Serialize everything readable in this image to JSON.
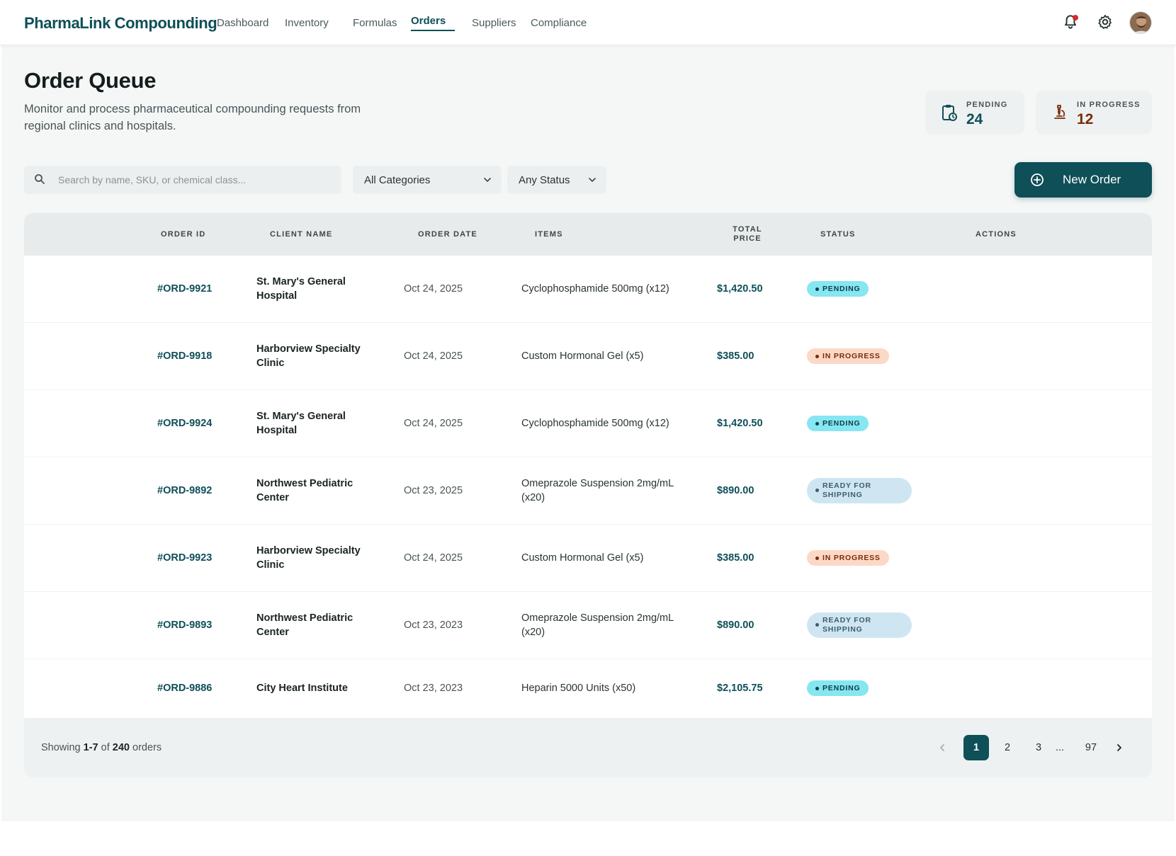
{
  "app": {
    "brand": "PharmaLink Compounding"
  },
  "nav": {
    "items": [
      {
        "label": "Dashboard",
        "active": false
      },
      {
        "label": "Inventory",
        "active": false
      },
      {
        "label": "Formulas",
        "active": false
      },
      {
        "label": "Orders",
        "active": true
      },
      {
        "label": "Suppliers",
        "active": false
      },
      {
        "label": "Compliance",
        "active": false
      }
    ],
    "icons": [
      "bell-icon",
      "gear-icon",
      "avatar"
    ]
  },
  "header": {
    "title": "Order Queue",
    "description": "Monitor and process pharmaceutical compounding requests from regional clinics and hospitals."
  },
  "stats": [
    {
      "label": "PENDING",
      "value": "24",
      "icon": "clipboard-clock-icon",
      "color": "#0f4f58"
    },
    {
      "label": "IN PROGRESS",
      "value": "12",
      "icon": "microscope-icon",
      "color": "#7a2b09"
    }
  ],
  "filters": {
    "search_placeholder": "Search by name, SKU, or chemical class...",
    "category": "All Categories",
    "status": "Any Status",
    "new_order_label": "New Order"
  },
  "table": {
    "columns": [
      "ORDER ID",
      "CLIENT NAME",
      "ORDER DATE",
      "ITEMS",
      "TOTAL PRICE",
      "STATUS",
      "ACTIONS"
    ],
    "rows": [
      {
        "id": "#ORD-9921",
        "client": "St. Mary's General Hospital",
        "date": "Oct 24, 2025",
        "items": "Cyclophosphamide 500mg (x12)",
        "price": "$1,420.50",
        "status": "PENDING",
        "status_kind": "pending"
      },
      {
        "id": "#ORD-9918",
        "client": "Harborview Specialty Clinic",
        "date": "Oct 24, 2025",
        "items": "Custom Hormonal Gel (x5)",
        "price": "$385.00",
        "status": "IN PROGRESS",
        "status_kind": "progress"
      },
      {
        "id": "#ORD-9924",
        "client": "St. Mary's General Hospital",
        "date": "Oct 24, 2025",
        "items": "Cyclophosphamide 500mg (x12)",
        "price": "$1,420.50",
        "status": "PENDING",
        "status_kind": "pending"
      },
      {
        "id": "#ORD-9892",
        "client": "Northwest Pediatric Center",
        "date": "Oct 23, 2025",
        "items": "Omeprazole Suspension 2mg/mL (x20)",
        "price": "$890.00",
        "status": "READY FOR SHIPPING",
        "status_kind": "ready"
      },
      {
        "id": "#ORD-9923",
        "client": "Harborview Specialty Clinic",
        "date": "Oct 24, 2025",
        "items": "Custom Hormonal Gel (x5)",
        "price": "$385.00",
        "status": "IN PROGRESS",
        "status_kind": "progress"
      },
      {
        "id": "#ORD-9893",
        "client": "Northwest Pediatric Center",
        "date": "Oct 23, 2023",
        "items": "Omeprazole Suspension 2mg/mL (x20)",
        "price": "$890.00",
        "status": "READY FOR SHIPPING",
        "status_kind": "ready"
      },
      {
        "id": "#ORD-9886",
        "client": "City Heart Institute",
        "date": "Oct 23, 2023",
        "items": "Heparin 5000 Units (x50)",
        "price": "$2,105.75",
        "status": "PENDING",
        "status_kind": "pending"
      }
    ]
  },
  "footer": {
    "showing_prefix": "Showing",
    "showing_range": "1-7",
    "showing_of": "of",
    "showing_total": "240",
    "showing_suffix": "orders",
    "pages": [
      "1",
      "2",
      "3",
      "...",
      "97"
    ],
    "current_page": "1"
  },
  "colors": {
    "accent": "#0f4f58",
    "pending_badge": "#86e6f1",
    "progress_badge": "#fcd9c6",
    "ready_badge": "#cfe6f2",
    "notification_dot": "#d62b2b"
  }
}
